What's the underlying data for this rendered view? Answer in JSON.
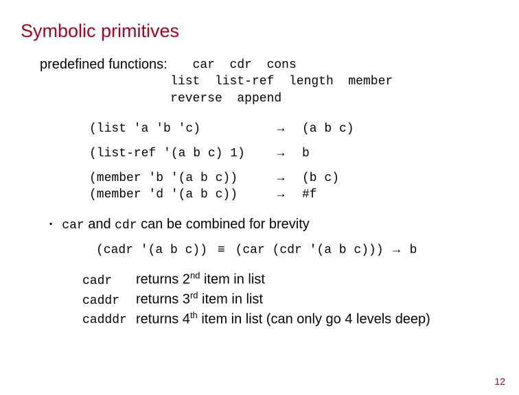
{
  "title": "Symbolic primitives",
  "predef_label": "predefined functions:",
  "fn_lines": {
    "l1": "   car  cdr  cons",
    "l2": "list  list-ref  length  member",
    "l3": "reverse  append"
  },
  "examples": [
    {
      "expr": "(list 'a 'b 'c)",
      "arrow": "→",
      "result": "(a b c)",
      "gap": true
    },
    {
      "expr": "(list-ref '(a b c) 1)",
      "arrow": "→",
      "result": "b",
      "gap": true
    },
    {
      "expr": "(member 'b '(a b c))",
      "arrow": "→",
      "result": "(b c)",
      "gap": false
    },
    {
      "expr": "(member 'd '(a b c))",
      "arrow": "→",
      "result": "#f",
      "gap": false
    }
  ],
  "bullet": {
    "marker": "▪",
    "code1": "car",
    "mid": " and ",
    "code2": "cdr",
    "tail": " can be combined for brevity"
  },
  "cadr": {
    "left": "(cadr '(a b c))",
    "equiv": "≡",
    "right": "(car (cdr '(a b c)))",
    "arrow": "→",
    "result": "b"
  },
  "shortcuts": [
    {
      "code": "cadr",
      "pre": "returns 2",
      "ord": "nd",
      "post": " item in list",
      "tail": ""
    },
    {
      "code": "caddr",
      "pre": "returns 3",
      "ord": "rd",
      "post": " item in list",
      "tail": ""
    },
    {
      "code": "cadddr",
      "pre": "returns 4",
      "ord": "th",
      "post": " item in list",
      "tail": "  (can only go 4 levels deep)"
    }
  ],
  "page_number": "12"
}
